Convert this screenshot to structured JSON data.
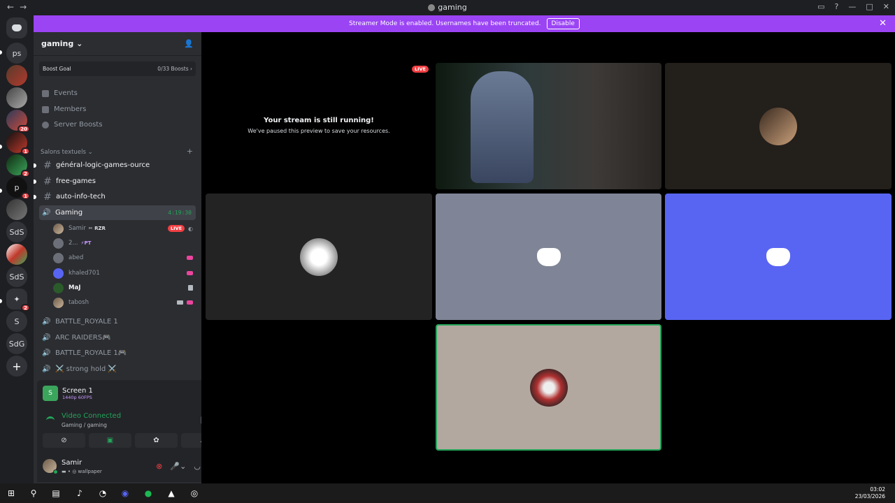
{
  "window": {
    "title": "gaming"
  },
  "banner": {
    "text": "Streamer Mode is enabled. Usernames have been truncated.",
    "disable_label": "Disable"
  },
  "guilds": [
    {
      "label": "ps"
    },
    {
      "label": ""
    },
    {
      "label": ""
    },
    {
      "label": "",
      "badge": "20"
    },
    {
      "label": "",
      "badge": "1"
    },
    {
      "label": "",
      "badge": "2"
    },
    {
      "label": "p",
      "badge": "1"
    },
    {
      "label": ""
    },
    {
      "label": "SdS"
    },
    {
      "label": ""
    },
    {
      "label": "SdS"
    },
    {
      "label": "",
      "badge": "2"
    },
    {
      "label": "S"
    },
    {
      "label": "SdG"
    },
    {
      "label": "+"
    }
  ],
  "server": {
    "name": "gaming",
    "boost_goal": "Boost Goal",
    "boost_count": "0/33 Boosts",
    "menu": [
      "Events",
      "Members",
      "Server Boosts"
    ],
    "category": "Salons textuels",
    "text_channels": [
      "général-logic-games-ource",
      "free-games",
      "auto-info-tech"
    ],
    "active_voice": {
      "name": "Gaming",
      "timer": "4:19:30"
    },
    "voice_users": [
      {
        "name": "Samir",
        "tag": "RZR",
        "live": "LIVE"
      },
      {
        "name": "2...",
        "tag": "PT"
      },
      {
        "name": "abed"
      },
      {
        "name": "khaled701"
      },
      {
        "name": "MaJ"
      },
      {
        "name": "tabosh"
      }
    ],
    "voice_channels": [
      "BATTLE_ROYALE 1",
      "ARC RAIDERS🎮",
      "BATTLE_ROYALE 1🎮",
      "⚔️ strong hold ⚔️"
    ]
  },
  "rtc": {
    "screen_title": "Screen 1",
    "screen_quality": "1440p 60FPS",
    "status": "Video Connected",
    "channel_path": "Gaming / gaming"
  },
  "user": {
    "name": "Samir",
    "status": "wallpaper"
  },
  "stage": {
    "paused_title": "Your stream is still running!",
    "paused_text": "We've paused this preview to save your resources.",
    "live_label": "LIVE"
  },
  "clock": {
    "time": "03:02",
    "date": "23/03/2026"
  },
  "colors": {
    "blurple": "#5865f2",
    "banner": "#9b44f4",
    "green": "#23a559",
    "red": "#f23f43"
  }
}
